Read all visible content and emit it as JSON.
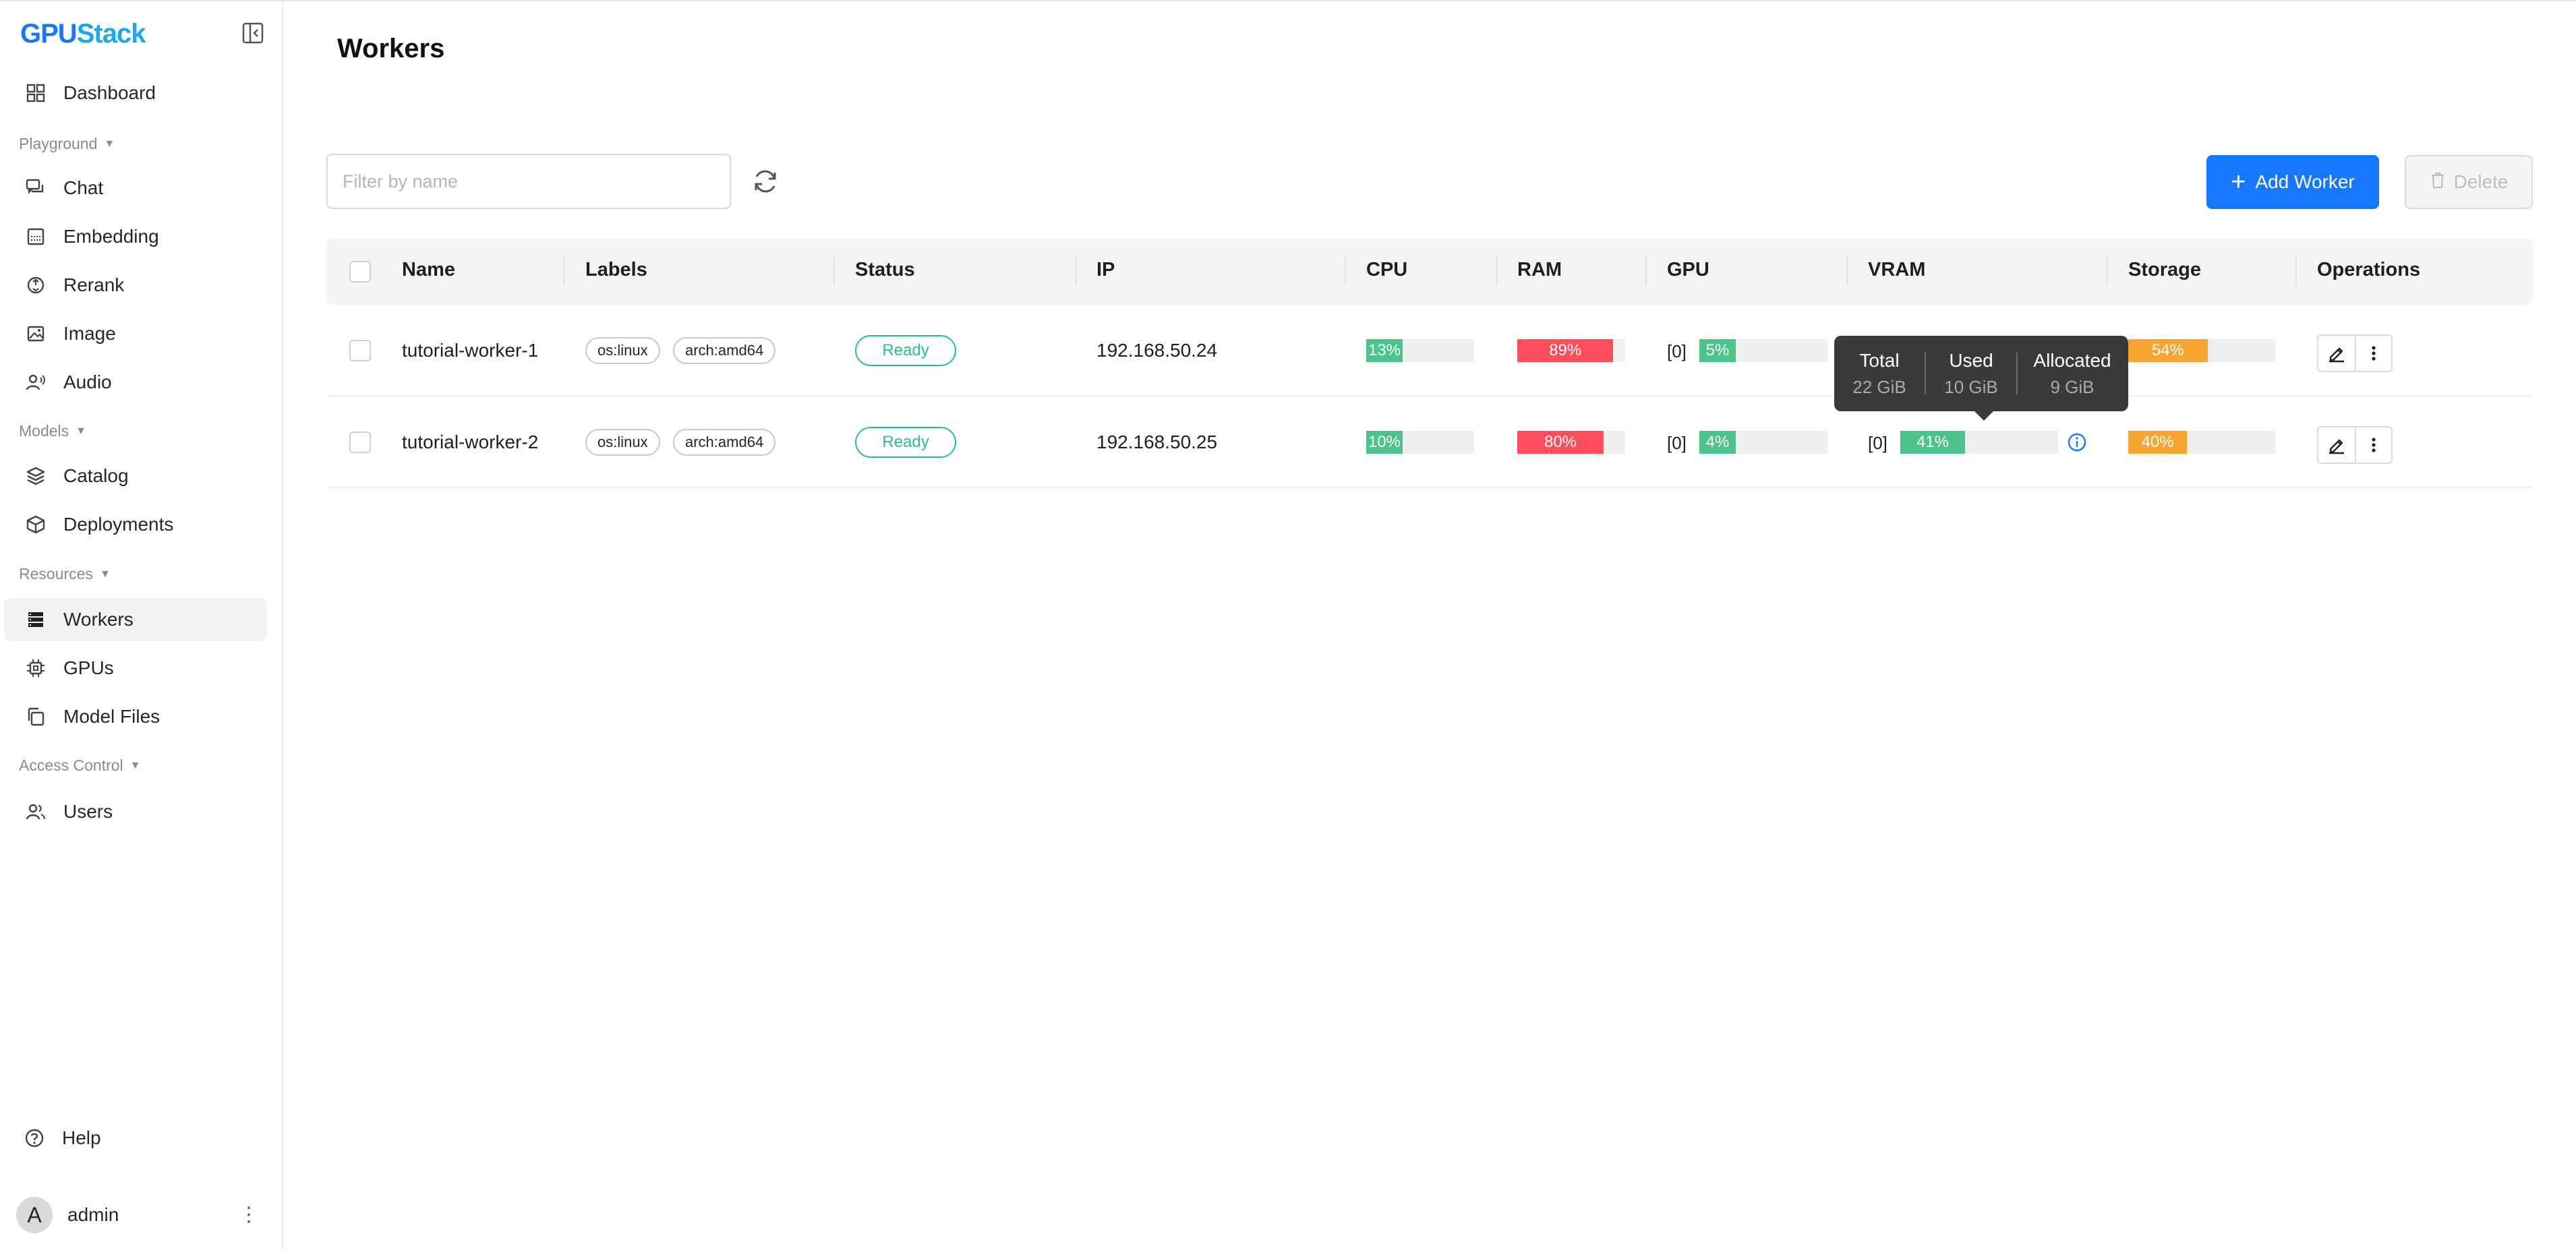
{
  "app": {
    "logo_a": "GPU",
    "logo_b": "Stack"
  },
  "sidebar": {
    "dashboard": "Dashboard",
    "group_playground": "Playground",
    "chat": "Chat",
    "embedding": "Embedding",
    "rerank": "Rerank",
    "image": "Image",
    "audio": "Audio",
    "group_models": "Models",
    "catalog": "Catalog",
    "deployments": "Deployments",
    "group_resources": "Resources",
    "workers": "Workers",
    "gpus": "GPUs",
    "model_files": "Model Files",
    "group_access": "Access Control",
    "users": "Users",
    "help": "Help",
    "user_initial": "A",
    "user_name": "admin"
  },
  "page": {
    "title": "Workers"
  },
  "toolbar": {
    "filter_placeholder": "Filter by name",
    "add_worker": "Add Worker",
    "delete": "Delete"
  },
  "table": {
    "headers": {
      "name": "Name",
      "labels": "Labels",
      "status": "Status",
      "ip": "IP",
      "cpu": "CPU",
      "ram": "RAM",
      "gpu": "GPU",
      "vram": "VRAM",
      "storage": "Storage",
      "operations": "Operations"
    },
    "rows": [
      {
        "name": "tutorial-worker-1",
        "labels": [
          "os:linux",
          "arch:amd64"
        ],
        "status": "Ready",
        "ip": "192.168.50.24",
        "cpu": {
          "text": "13%",
          "value": 0.13
        },
        "ram": {
          "text": "89%",
          "value": 0.89
        },
        "gpu": {
          "index": "[0]",
          "text": "5%",
          "value": 0.05
        },
        "storage": {
          "text": "54%",
          "value": 0.54
        }
      },
      {
        "name": "tutorial-worker-2",
        "labels": [
          "os:linux",
          "arch:amd64"
        ],
        "status": "Ready",
        "ip": "192.168.50.25",
        "cpu": {
          "text": "10%",
          "value": 0.1
        },
        "ram": {
          "text": "80%",
          "value": 0.8
        },
        "gpu": {
          "index": "[0]",
          "text": "4%",
          "value": 0.04
        },
        "vram": {
          "index": "[0]",
          "text": "41%",
          "value": 0.41
        },
        "storage": {
          "text": "40%",
          "value": 0.4
        }
      }
    ]
  },
  "tooltip": {
    "total_label": "Total",
    "total_value": "22 GiB",
    "used_label": "Used",
    "used_value": "10 GiB",
    "allocated_label": "Allocated",
    "allocated_value": "9 GiB"
  },
  "colors": {
    "primary": "#1677ff",
    "ok_green": "#4cc38a",
    "danger_red": "#ff4d5b",
    "warn_orange": "#f7a531",
    "status_green": "#2dbe86"
  }
}
